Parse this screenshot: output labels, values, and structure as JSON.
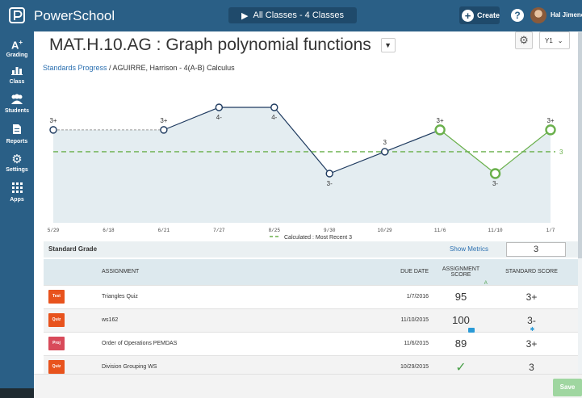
{
  "app": {
    "name": "PowerSchool"
  },
  "topbar": {
    "classes_label": "All Classes  -  4 Classes",
    "create_label": "Create",
    "user_name": "Hal Jimenez"
  },
  "sidebar": {
    "items": [
      {
        "label": "Grading",
        "icon": "grading-icon"
      },
      {
        "label": "Class",
        "icon": "class-icon"
      },
      {
        "label": "Students",
        "icon": "students-icon"
      },
      {
        "label": "Reports",
        "icon": "reports-icon"
      },
      {
        "label": "Settings",
        "icon": "settings-icon"
      },
      {
        "label": "Apps",
        "icon": "apps-icon"
      }
    ]
  },
  "header": {
    "title": "MAT.H.10.AG : Graph polynomial functions",
    "year": "Y1",
    "breadcrumb_link": "Standards Progress",
    "breadcrumb_rest": " / AGUIRRE, Harrison - 4(A-B) Calculus"
  },
  "chart_data": {
    "type": "line",
    "x": [
      "5/29",
      "6/18",
      "6/21",
      "7/27",
      "8/25",
      "9/30",
      "10/29",
      "11/6",
      "11/10",
      "1/7"
    ],
    "points": [
      {
        "x": "5/29",
        "label": "3+",
        "level": 3.33,
        "kind": "open-dark",
        "label_pos": "above"
      },
      {
        "x": "6/21",
        "label": "3+",
        "level": 3.33,
        "kind": "open-dark",
        "label_pos": "above"
      },
      {
        "x": "7/27",
        "label": "4-",
        "level": 3.67,
        "kind": "open-dark",
        "label_pos": "below"
      },
      {
        "x": "8/25",
        "label": "4-",
        "level": 3.67,
        "kind": "open-dark",
        "label_pos": "below"
      },
      {
        "x": "9/30",
        "label": "3-",
        "level": 2.67,
        "kind": "open-dark",
        "label_pos": "below"
      },
      {
        "x": "10/29",
        "label": "3",
        "level": 3.0,
        "kind": "open-dark",
        "label_pos": "above"
      },
      {
        "x": "11/6",
        "label": "3+",
        "level": 3.33,
        "kind": "recent",
        "label_pos": "above"
      },
      {
        "x": "11/10",
        "label": "3-",
        "level": 2.67,
        "kind": "recent",
        "label_pos": "below"
      },
      {
        "x": "1/7",
        "label": "3+",
        "level": 3.33,
        "kind": "recent",
        "label_pos": "above"
      }
    ],
    "calculated_line": {
      "value_label": "3",
      "level": 3.0
    },
    "legend": "Calculated : Most Recent 3",
    "colors": {
      "dark": "#1e3a5f",
      "green": "#6ab04c",
      "fill": "#e4edf1",
      "baseline_dash": "#999999"
    }
  },
  "standard_grade": {
    "label": "Standard Grade",
    "show_metrics": "Show Metrics",
    "value": "3"
  },
  "table": {
    "headers": {
      "assignment": "ASSIGNMENT",
      "due": "DUE DATE",
      "score_line1": "ASSIGNMENT",
      "score_line2": "SCORE",
      "standard": "STANDARD SCORE"
    },
    "rows": [
      {
        "cat": "Test",
        "cat_class": "test",
        "name": "Triangles Quiz",
        "due": "1/7/2016",
        "score": "95",
        "standard": "3+",
        "score_mark": "A"
      },
      {
        "cat": "Quiz",
        "cat_class": "quiz",
        "name": "ws162",
        "due": "11/10/2015",
        "score": "100",
        "standard": "3-"
      },
      {
        "cat": "Proj",
        "cat_class": "proj",
        "name": "Order of Operations PEMDAS",
        "due": "11/6/2015",
        "score": "89",
        "standard": "3+"
      },
      {
        "cat": "Quiz",
        "cat_class": "quiz",
        "name": "Division Grouping WS",
        "due": "10/29/2015",
        "score": "✓",
        "standard": "3"
      }
    ]
  },
  "footer": {
    "save_label": "Save"
  }
}
